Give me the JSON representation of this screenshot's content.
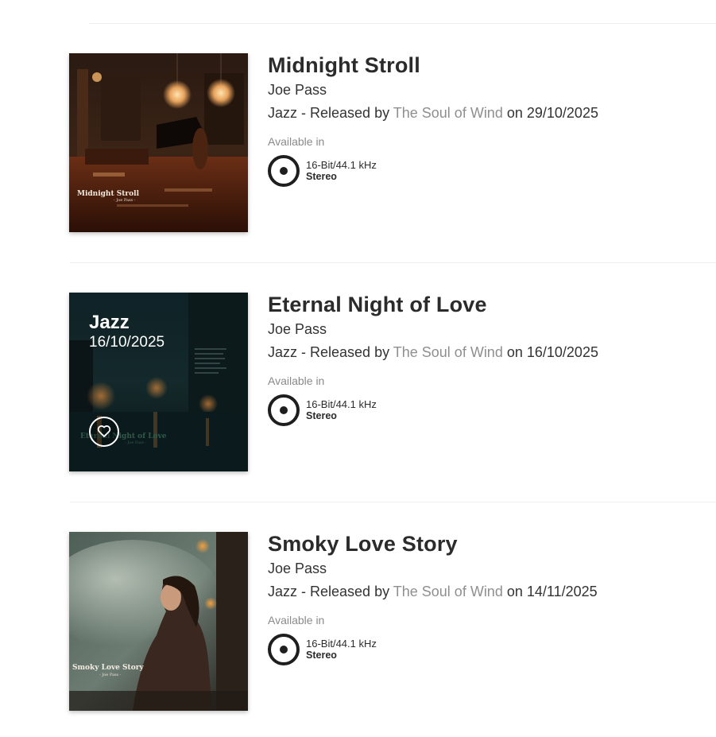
{
  "albums": [
    {
      "title": "Midnight Stroll",
      "artist": "Joe Pass",
      "genre": "Jazz",
      "released_by_text": " - Released by ",
      "label": "The Soul of Wind",
      "on_text": " on ",
      "release_date": "29/10/2025",
      "available_label": "Available in",
      "quality": "16-Bit/44.1 kHz",
      "channels": "Stereo",
      "cover_caption_title": "Midnight Stroll",
      "cover_caption_artist": "- Joe Pass -"
    },
    {
      "title": "Eternal Night of Love",
      "artist": "Joe Pass",
      "genre": "Jazz",
      "released_by_text": " - Released by ",
      "label": "The Soul of Wind",
      "on_text": " on ",
      "release_date": "16/10/2025",
      "available_label": "Available in",
      "quality": "16-Bit/44.1 kHz",
      "channels": "Stereo",
      "cover_overlay_genre": "Jazz",
      "cover_overlay_date": "16/10/2025",
      "cover_caption_title": "Eternal Night of Love",
      "cover_caption_artist": "- Joe Pass -"
    },
    {
      "title": "Smoky Love Story",
      "artist": "Joe Pass",
      "genre": "Jazz",
      "released_by_text": " - Released by ",
      "label": "The Soul of Wind",
      "on_text": " on ",
      "release_date": "14/11/2025",
      "available_label": "Available in",
      "quality": "16-Bit/44.1 kHz",
      "channels": "Stereo",
      "cover_caption_title": "Smoky Love Story",
      "cover_caption_artist": "- Joe Pass -"
    }
  ],
  "icons": {
    "quality": "disc-icon",
    "favorite": "heart-icon"
  },
  "colors": {
    "text": "#2b2b2b",
    "label_link": "#8f8f8f",
    "muted": "#8a8a8a",
    "divider": "#eeeeee"
  }
}
